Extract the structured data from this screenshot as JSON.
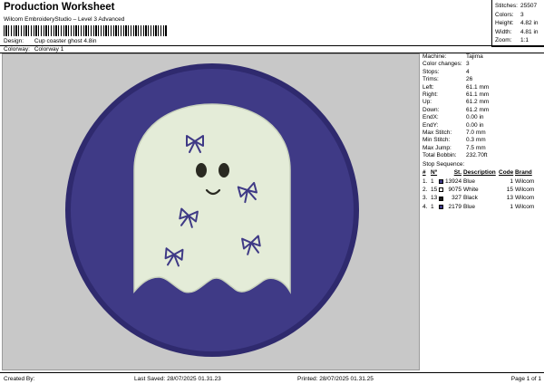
{
  "header": {
    "title": "Production Worksheet",
    "subtitle": "Wilcom EmbroideryStudio – Level 3 Advanced",
    "design_label": "Design:",
    "design_value": "Cup coaster ghost 4.8in",
    "colorway_label": "Colorway:",
    "colorway_value": "Colorway 1"
  },
  "stats": [
    {
      "label": "Stitches:",
      "value": "25507"
    },
    {
      "label": "Colors:",
      "value": "3"
    },
    {
      "label": "Height:",
      "value": "4.82 in"
    },
    {
      "label": "Width:",
      "value": "4.81 in"
    },
    {
      "label": "Zoom:",
      "value": "1:1"
    }
  ],
  "machine_info": [
    {
      "label": "Machine:",
      "value": "Tajima"
    },
    {
      "label": "Color changes:",
      "value": "3"
    },
    {
      "label": "Stops:",
      "value": "4"
    },
    {
      "label": "Trims:",
      "value": "26"
    },
    {
      "label": "Left:",
      "value": "61.1 mm"
    },
    {
      "label": "Right:",
      "value": "61.1 mm"
    },
    {
      "label": "Up:",
      "value": "61.2 mm"
    },
    {
      "label": "Down:",
      "value": "61.2 mm"
    },
    {
      "label": "EndX:",
      "value": "0.00 in"
    },
    {
      "label": "EndY:",
      "value": "0.00 in"
    },
    {
      "label": "Max Stitch:",
      "value": "7.0 mm"
    },
    {
      "label": "Min Stitch:",
      "value": "0.3 mm"
    },
    {
      "label": "Max Jump:",
      "value": "7.5 mm"
    },
    {
      "label": "Total Bobbin:",
      "value": "232.70ft"
    }
  ],
  "stop_sequence": {
    "title": "Stop Sequence:",
    "headers": {
      "hash": "#",
      "n": "Nº",
      "st": "St.",
      "desc": "Description",
      "code": "Code",
      "brand": "Brand"
    },
    "rows": [
      {
        "idx": "1.",
        "n": "1",
        "color": "#3f3a86",
        "st": "13924",
        "desc": "Blue",
        "code": "1",
        "brand": "Wilcom"
      },
      {
        "idx": "2.",
        "n": "15",
        "color": "#ffffff",
        "st": "9075",
        "desc": "White",
        "code": "15",
        "brand": "Wilcom"
      },
      {
        "idx": "3.",
        "n": "13",
        "color": "#1a1a1a",
        "st": "327",
        "desc": "Black",
        "code": "13",
        "brand": "Wilcom"
      },
      {
        "idx": "4.",
        "n": "1",
        "color": "#3f3a86",
        "st": "2179",
        "desc": "Blue",
        "code": "1",
        "brand": "Wilcom"
      }
    ]
  },
  "footer": {
    "created_by": "Created By:",
    "last_saved": "Last Saved: 28/07/2025 01.31.23",
    "printed": "Printed: 28/07/2025 01.31.25",
    "page": "Page 1 of 1"
  },
  "colors": {
    "canvas_bg": "#c8c8c8",
    "coaster_purple": "#3f3a86",
    "ghost_fill": "#e4ecd8",
    "eyes": "#2a2a22"
  }
}
